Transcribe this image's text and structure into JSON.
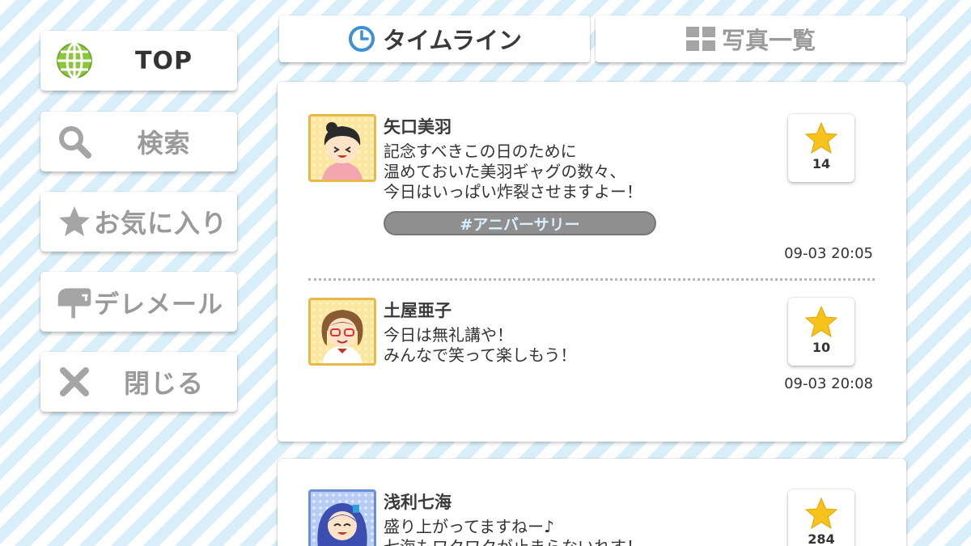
{
  "sidebar": {
    "items": [
      {
        "label": "TOP",
        "icon": "globe-icon"
      },
      {
        "label": "検索",
        "icon": "search-icon"
      },
      {
        "label": "お気に入り",
        "icon": "star-icon"
      },
      {
        "label": "デレメール",
        "icon": "mailbox-icon"
      },
      {
        "label": "閉じる",
        "icon": "close-icon"
      }
    ]
  },
  "tabs": [
    {
      "label": "タイムライン",
      "icon": "clock-icon",
      "active": true
    },
    {
      "label": "写真一覧",
      "icon": "grid-icon",
      "active": false
    }
  ],
  "posts": [
    {
      "name": "矢口美羽",
      "lines": [
        "記念すべきこの日のために",
        "温めておいた美羽ギャグの数々、",
        "今日はいっぱい炸裂させますよー！"
      ],
      "hashtag": "#アニバーサリー",
      "time": "09-03 20:05",
      "likes": "14"
    },
    {
      "name": "土屋亜子",
      "lines": [
        "今日は無礼講や！",
        "みんなで笑って楽しもう！"
      ],
      "time": "09-03 20:08",
      "likes": "10"
    },
    {
      "name": "浅利七海",
      "lines": [
        "盛り上がってますねー♪",
        "七海もワクワクが止まらないれす！"
      ],
      "likes": "284"
    }
  ],
  "colors": {
    "accent_blue": "#3d8fd6",
    "star_yellow": "#f6c21b",
    "globe_green": "#8cc63f",
    "inactive_gray": "#9a9a9a",
    "stripe": "#d8eef9"
  }
}
